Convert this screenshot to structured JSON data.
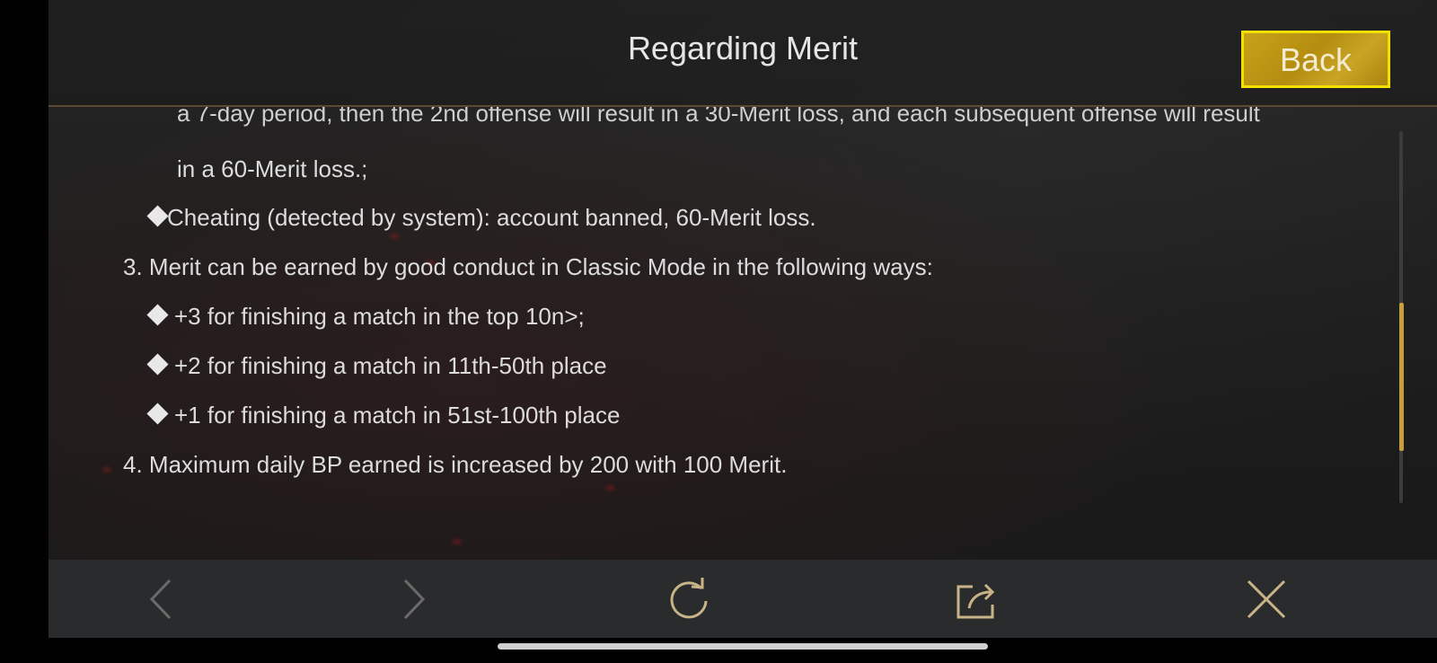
{
  "header": {
    "title": "Regarding Merit",
    "back_label": "Back"
  },
  "content": {
    "partial_line": "a 7-day period, then the 2nd offense will result in a 30-Merit loss, and each subsequent offense will result",
    "lines": [
      "in a 60-Merit loss.;",
      "Cheating (detected by system): account banned, 60-Merit loss.",
      "3. Merit can be earned by good conduct in Classic Mode in the following ways:",
      "+3 for finishing a match in the top 10n>;",
      "+2 for finishing a match in 11th-50th place",
      "+1 for finishing a match in 51st-100th place",
      "4. Maximum daily BP earned is increased by 200 with 100 Merit."
    ]
  },
  "toolbar": {
    "icons": [
      "chevron-left-icon",
      "chevron-right-icon",
      "refresh-icon",
      "share-icon",
      "close-icon"
    ]
  },
  "colors": {
    "accent": "#c79e3a",
    "back_button_border": "#f2e100",
    "background": "#1d1d1d"
  }
}
